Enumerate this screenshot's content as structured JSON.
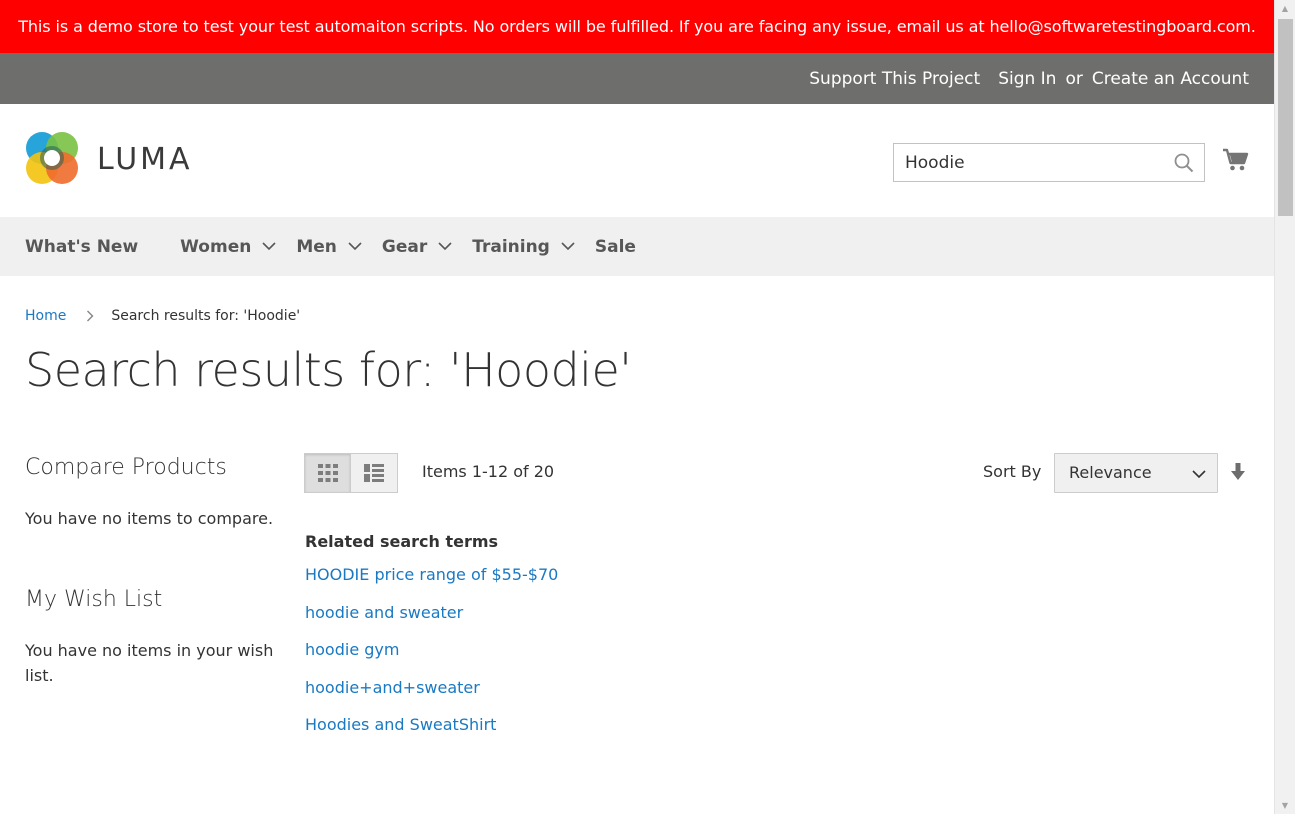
{
  "demo_notice": "This is a demo store to test your test automaiton scripts. No orders will be fulfilled. If you are facing any issue, email us at hello@softwaretestingboard.com.",
  "panel": {
    "support": "Support This Project",
    "sign_in": "Sign In",
    "or": "or",
    "create_account": "Create an Account"
  },
  "logo": {
    "text": "LUMA"
  },
  "search": {
    "value": "Hoodie"
  },
  "nav": {
    "items": [
      {
        "label": "What's New"
      },
      {
        "label": "Women"
      },
      {
        "label": "Men"
      },
      {
        "label": "Gear"
      },
      {
        "label": "Training"
      },
      {
        "label": "Sale"
      }
    ]
  },
  "breadcrumbs": {
    "home": "Home",
    "current": "Search results for: 'Hoodie'"
  },
  "page_title": "Search results for: 'Hoodie'",
  "sidebar": {
    "compare_title": "Compare Products",
    "compare_empty": "You have no items to compare.",
    "wishlist_title": "My Wish List",
    "wishlist_empty": "You have no items in your wish list."
  },
  "toolbar": {
    "amount": "Items 1-12 of 20",
    "sort_label": "Sort By",
    "sort_value": "Relevance"
  },
  "related": {
    "title": "Related search terms",
    "terms": [
      "HOODIE price range of $55-$70",
      "hoodie and sweater",
      "hoodie gym",
      "hoodie+and+sweater",
      "Hoodies and SweatShirt"
    ]
  },
  "colors": {
    "notice_bg": "#ff0000",
    "panel_bg": "#6e6e6c",
    "nav_bg": "#f0f0f0",
    "link": "#1979c3"
  }
}
